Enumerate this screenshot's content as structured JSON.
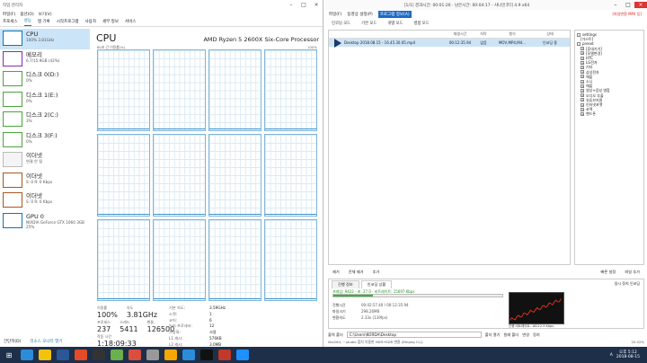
{
  "taskmgr": {
    "title": "작업 관리자",
    "menu": [
      "파일(F)",
      "옵션(O)",
      "보기(V)"
    ],
    "tabs": [
      "프로세스",
      "성능",
      "앱 기록",
      "시작프로그램",
      "사용자",
      "세부 정보",
      "서비스"
    ],
    "active_tab": 1,
    "sidebar": [
      {
        "name": "CPU",
        "value": "100% 3.81GHz",
        "kind": "cpu"
      },
      {
        "name": "메모리",
        "value": "6.7/15.9GB (42%)",
        "kind": "mem"
      },
      {
        "name": "디스크 0(D:)",
        "value": "0%",
        "kind": "disk"
      },
      {
        "name": "디스크 1(E:)",
        "value": "0%",
        "kind": "disk"
      },
      {
        "name": "디스크 2(C:)",
        "value": "3%",
        "kind": "disk"
      },
      {
        "name": "디스크 3(F:)",
        "value": "0%",
        "kind": "disk"
      },
      {
        "name": "이더넷",
        "value": "연결 안 됨",
        "kind": "plain"
      },
      {
        "name": "이더넷",
        "value": "S: 0 R: 0 Kbps",
        "kind": "eth"
      },
      {
        "name": "이더넷",
        "value": "S: 0 R: 0 Kbps",
        "kind": "eth"
      },
      {
        "name": "GPU 0",
        "value": "NVIDIA GeForce GTX 1060 3GB 25%",
        "kind": "gpu"
      }
    ],
    "main": {
      "title": "CPU",
      "model": "AMD Ryzen 5 2600X Six-Core Processor",
      "util_label": "60초 간 이용률(%)",
      "util_max": "100%"
    },
    "stats": {
      "usage_label": "이용률",
      "usage": "100%",
      "speed_label": "속도",
      "speed": "3.81GHz",
      "proc_label": "프로세스",
      "proc": "237",
      "threads_label": "스레드",
      "threads": "5411",
      "handles_label": "핸들",
      "handles": "126500",
      "uptime_label": "작동 시간",
      "uptime": "1:18:09:33"
    },
    "specs": [
      {
        "k": "기본 속도:",
        "v": "3.59GHz"
      },
      {
        "k": "소켓:",
        "v": "1"
      },
      {
        "k": "코어:",
        "v": "6"
      },
      {
        "k": "논리 프로세서:",
        "v": "12"
      },
      {
        "k": "가상화:",
        "v": "사용"
      },
      {
        "k": "L1 캐시:",
        "v": "576KB"
      },
      {
        "k": "L2 캐시:",
        "v": "3.0MB"
      },
      {
        "k": "L3 캐시:",
        "v": "16.0MB"
      }
    ],
    "status": {
      "less": "간단히(D)",
      "open_monitor": "리소스 모니터 열기"
    }
  },
  "encoder": {
    "title": "[1/1] 경과시간: 00:01:26 · 남은시간: 00:04:17 - 샤나인코더 4.9 x64",
    "menu": [
      "파일(F)",
      "동영상 설정(P)",
      "프로그램 정보(A)"
    ],
    "active_menu": 2,
    "promo": "[파일변환 MP4 등]",
    "toolbar": [
      "인코딩 모드",
      "기본 모드",
      "개별 모드",
      "병합 모드"
    ],
    "list_headers": {
      "name": "",
      "dur": "재생시간",
      "fmt": "자막",
      "form": "형식",
      "stat": "상태"
    },
    "list_rows": [
      {
        "name": "Desktop 2018.08.15 - 16.45.30.05.mp4",
        "dur": "00:12:35.94",
        "fmt": "없음",
        "form": "MOV,MP4,M4...",
        "stat": "인코딩 중"
      }
    ],
    "tree": [
      {
        "label": "settings",
        "lvl": 0,
        "box": "-"
      },
      {
        "label": "[가스트]",
        "lvl": 1,
        "box": ""
      },
      {
        "label": "preset",
        "lvl": 0,
        "box": "-"
      },
      {
        "label": "[휴대기기]",
        "lvl": 1,
        "box": "+"
      },
      {
        "label": "[모델변경]",
        "lvl": 1,
        "box": "+"
      },
      {
        "label": "HTC",
        "lvl": 1,
        "box": "+"
      },
      {
        "label": "LG전자",
        "lvl": 1,
        "box": "+"
      },
      {
        "label": "기타",
        "lvl": 1,
        "box": "+"
      },
      {
        "label": "삼성전자",
        "lvl": 1,
        "box": "+"
      },
      {
        "label": "애플",
        "lvl": 1,
        "box": "+"
      },
      {
        "label": "소니",
        "lvl": 1,
        "box": "+"
      },
      {
        "label": "애플",
        "lvl": 1,
        "box": "+"
      },
      {
        "label": "영상+음성 병합",
        "lvl": 1,
        "box": "+"
      },
      {
        "label": "오디오 추출",
        "lvl": 1,
        "box": "+"
      },
      {
        "label": "유튜브지원",
        "lvl": 1,
        "box": "+"
      },
      {
        "label": "인터넷포맷",
        "lvl": 1,
        "box": "+"
      },
      {
        "label": "코덱",
        "lvl": 1,
        "box": "+"
      },
      {
        "label": "핸드폰",
        "lvl": 1,
        "box": "+"
      }
    ],
    "buttons": {
      "remove": "제거",
      "remove_all": "전체 제거",
      "add": "추가",
      "quick_settings": "빠른 설정",
      "add_file": "파일 추가"
    },
    "progress": {
      "tabs": [
        "진행 정보",
        "인코딩 상황"
      ],
      "rate": "프레임: 9422 · 초: 27.0 · 비트레이트: 15697 Kbps",
      "rows": [
        {
          "k": "진행시간",
          "v": "00:02:57.40 / 00:12:35.94"
        },
        {
          "k": "파일크기",
          "v": "298.26MB"
        },
        {
          "k": "변환속도",
          "v": "2.33x (139fps)"
        }
      ],
      "fraction": 0.235,
      "chart_label": "진행 비트레이트: 16212.9 Kbps",
      "side": [
        "일시 정지",
        "인코딩"
      ]
    },
    "output": {
      "label": "출력 폴더",
      "path": "C:\\Users\\KORDA\\Desktop",
      "open": "폴더 열기",
      "default": "원래 폴더",
      "change": "변경",
      "stop": "정지"
    },
    "status": {
      "left": "libx264, ~(audio 합치 이용한 HDR→SDR 변환 (ffmpeg CL))",
      "right": "20.02%"
    }
  },
  "taskbar": {
    "icons": [
      "#2b8cd8",
      "#f4c20d",
      "#2b5797",
      "#e34c26",
      "#333",
      "#6ab04c",
      "#d94f3d",
      "#999",
      "#f7a800",
      "#2b8cd8",
      "#111",
      "#c0392b",
      "#1e90ff"
    ],
    "lang": "A",
    "time": "오후 5:12",
    "date": "2018-08-15"
  }
}
